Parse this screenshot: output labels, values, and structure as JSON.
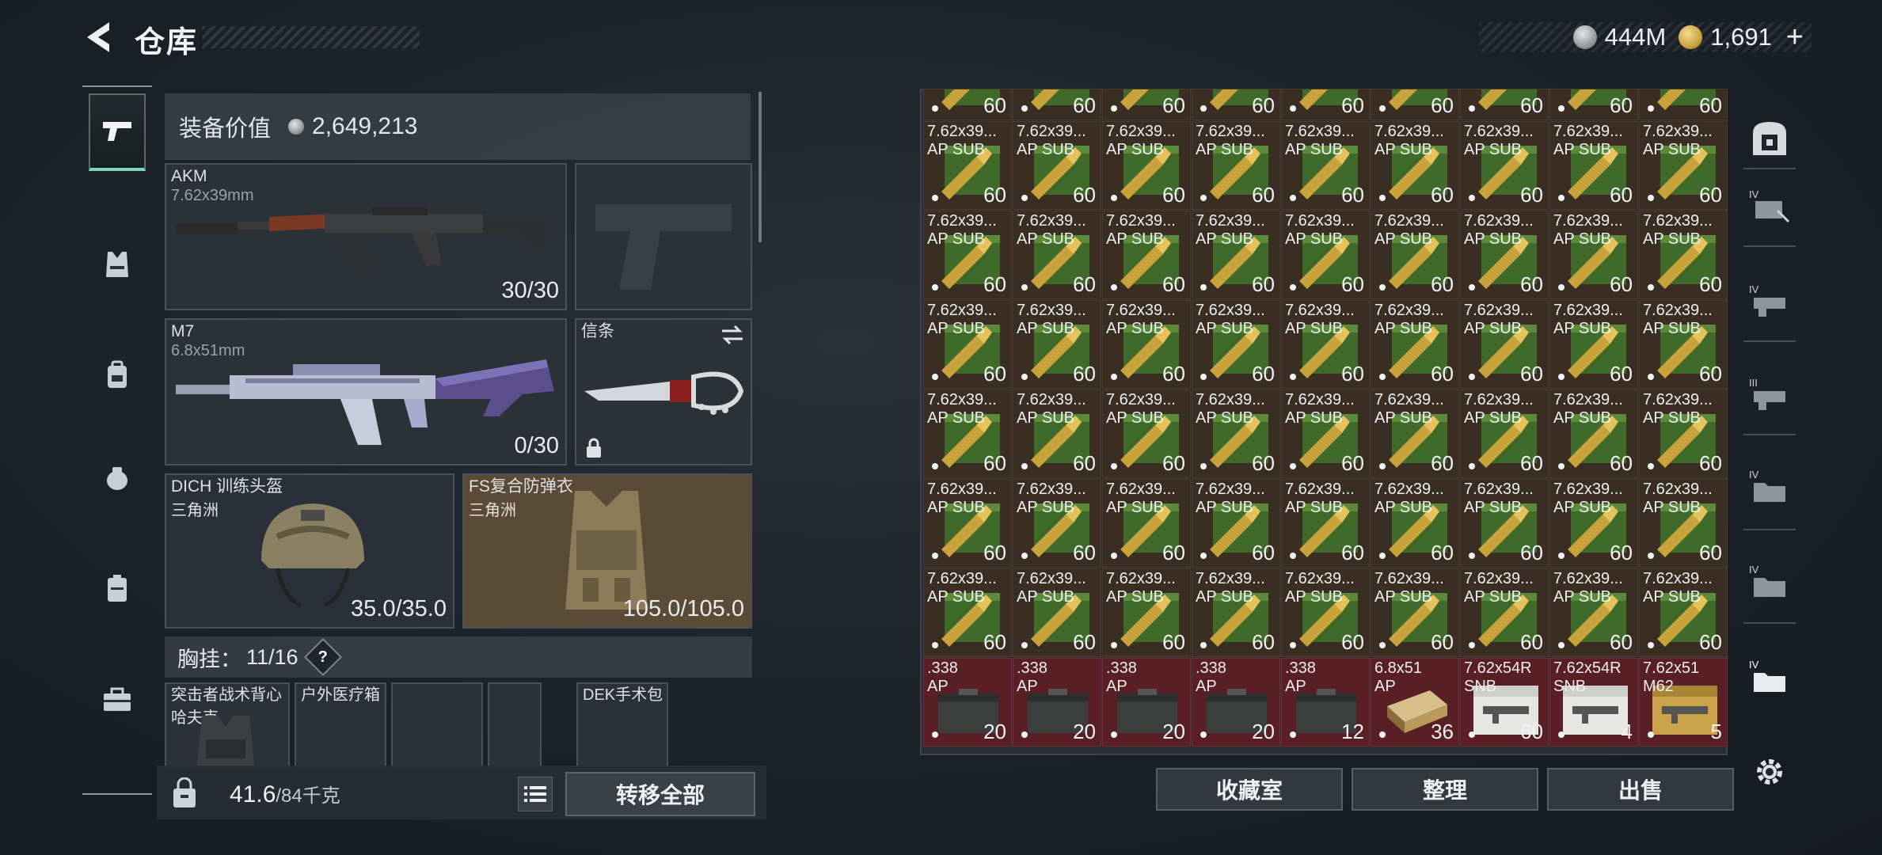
{
  "header": {
    "title": "仓库",
    "back_icon": "back-arrow-icon"
  },
  "currency": {
    "silver": {
      "icon": "silver-coin-icon",
      "value": "444M"
    },
    "gold": {
      "icon": "gold-coin-icon",
      "value": "1,691"
    },
    "plus_label": "+"
  },
  "left_rail": {
    "items": [
      {
        "icon": "pistol-icon",
        "active": true
      },
      {
        "icon": "armor-vest-icon",
        "active": false
      },
      {
        "icon": "backpack-icon",
        "active": false
      },
      {
        "icon": "pouch-icon",
        "active": false
      },
      {
        "icon": "case-icon",
        "active": false
      },
      {
        "icon": "toolbox-icon",
        "active": false
      }
    ]
  },
  "equipment": {
    "value_label": "装备价值",
    "value": "2,649,213",
    "primary_weapon": {
      "name": "AKM",
      "caliber": "7.62x39mm",
      "ammo": "30/30"
    },
    "secondary_weapon": {
      "name": "M7",
      "caliber": "6.8x51mm",
      "ammo": "0/30"
    },
    "melee": {
      "name": "信条",
      "swap_icon": "swap-icon",
      "lock_icon": "lock-icon"
    },
    "helmet": {
      "name": "DICH 训练头盔",
      "origin": "三角洲",
      "durability": "35.0/35.0"
    },
    "armor": {
      "name": "FS复合防弹衣",
      "origin": "三角洲",
      "durability": "105.0/105.0"
    },
    "chest_rig": {
      "label": "胸挂：",
      "value": "11/16",
      "help": "?"
    },
    "mini_slots": [
      {
        "name": "突击者战术背心",
        "sub": "哈夫克"
      },
      {
        "name": "户外医疗箱",
        "sub": ""
      },
      {
        "name": "",
        "sub": ""
      },
      {
        "name": "",
        "sub": ""
      },
      {
        "name": "DEK手术包",
        "sub": ""
      }
    ],
    "weight": {
      "current": "41.6",
      "capacity": "/84千克"
    },
    "transfer_label": "转移全部"
  },
  "storage": {
    "top_row": [
      {
        "count": "60"
      },
      {
        "count": "60"
      },
      {
        "count": "60"
      },
      {
        "count": "60"
      },
      {
        "count": "60"
      },
      {
        "count": "60"
      },
      {
        "count": "60"
      },
      {
        "count": "60"
      },
      {
        "count": "60"
      }
    ],
    "ammo_rows": 6,
    "ammo_item": {
      "name": "7.62x39...",
      "tag": "AP SUB",
      "count": "60"
    },
    "last_row": [
      {
        "name": ".338",
        "tag": "AP",
        "count": "20",
        "kind": "box"
      },
      {
        "name": ".338",
        "tag": "AP",
        "count": "20",
        "kind": "box"
      },
      {
        "name": ".338",
        "tag": "AP",
        "count": "20",
        "kind": "box"
      },
      {
        "name": ".338",
        "tag": "AP",
        "count": "20",
        "kind": "box"
      },
      {
        "name": ".338",
        "tag": "AP",
        "count": "12",
        "kind": "box"
      },
      {
        "name": "6.8x51",
        "tag": "AP",
        "count": "36",
        "kind": "pack"
      },
      {
        "name": "7.62x54R",
        "tag": "SNB",
        "count": "60",
        "kind": "carton"
      },
      {
        "name": "7.62x54R",
        "tag": "SNB",
        "count": "4",
        "kind": "carton"
      },
      {
        "name": "7.62x51",
        "tag": "M62",
        "count": "5",
        "kind": "goldcarton"
      }
    ]
  },
  "right_rail": {
    "items": [
      {
        "icon": "safe-box-icon"
      },
      {
        "icon": "tier-iv-case-icon"
      },
      {
        "icon": "tier-iv-case-icon"
      },
      {
        "icon": "tier-iii-case-icon"
      },
      {
        "icon": "tier-iv-folder-icon"
      },
      {
        "icon": "tier-iv-folder-icon"
      },
      {
        "icon": "tier-iv-folder-icon"
      },
      {
        "icon": "gear-icon"
      }
    ]
  },
  "actions": {
    "collection": "收藏室",
    "sort": "整理",
    "sell": "出售"
  },
  "colors": {
    "accent": "#7fd6bf",
    "ammo_cell": "#3a2e22",
    "rare_cell": "#5a1f24"
  }
}
